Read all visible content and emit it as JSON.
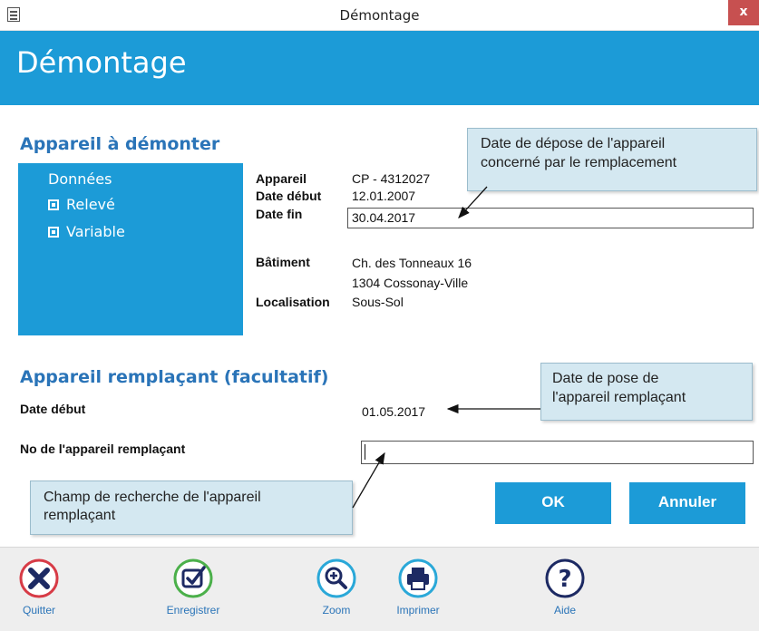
{
  "window": {
    "title": "Démontage",
    "close_label": "x"
  },
  "header": {
    "title": "Démontage"
  },
  "appareil_demonter": {
    "section_title": "Appareil à démonter",
    "panel": {
      "heading": "Données",
      "items": [
        "Relevé",
        "Variable"
      ]
    },
    "fields": {
      "appareil_label": "Appareil",
      "appareil_value": "CP - 4312027",
      "date_debut_label": "Date début",
      "date_debut_value": "12.01.2007",
      "date_fin_label": "Date fin",
      "date_fin_value": "30.04.2017",
      "batiment_label": "Bâtiment",
      "batiment_line1": "Ch. des Tonneaux 16",
      "batiment_line2": "1304 Cossonay-Ville",
      "localisation_label": "Localisation",
      "localisation_value": "Sous-Sol"
    }
  },
  "appareil_remplacant": {
    "section_title": "Appareil remplaçant (facultatif)",
    "date_debut_label": "Date début",
    "date_debut_value": "01.05.2017",
    "no_label": "No de l'appareil remplaçant",
    "no_value": ""
  },
  "callouts": {
    "date_depose": [
      "Date de dépose de l'appareil",
      "concerné par le remplacement"
    ],
    "date_pose": [
      "Date de pose de",
      "l'appareil remplaçant"
    ],
    "recherche": [
      "Champ de recherche de l'appareil",
      "remplaçant"
    ]
  },
  "buttons": {
    "ok": "OK",
    "annuler": "Annuler"
  },
  "toolbar": {
    "quitter": "Quitter",
    "enregistrer": "Enregistrer",
    "zoom": "Zoom",
    "imprimer": "Imprimer",
    "aide": "Aide"
  },
  "colors": {
    "accent": "#1c9bd7",
    "section_title": "#2a74b8",
    "callout_bg": "#d4e8f1",
    "close_red": "#c75050"
  }
}
